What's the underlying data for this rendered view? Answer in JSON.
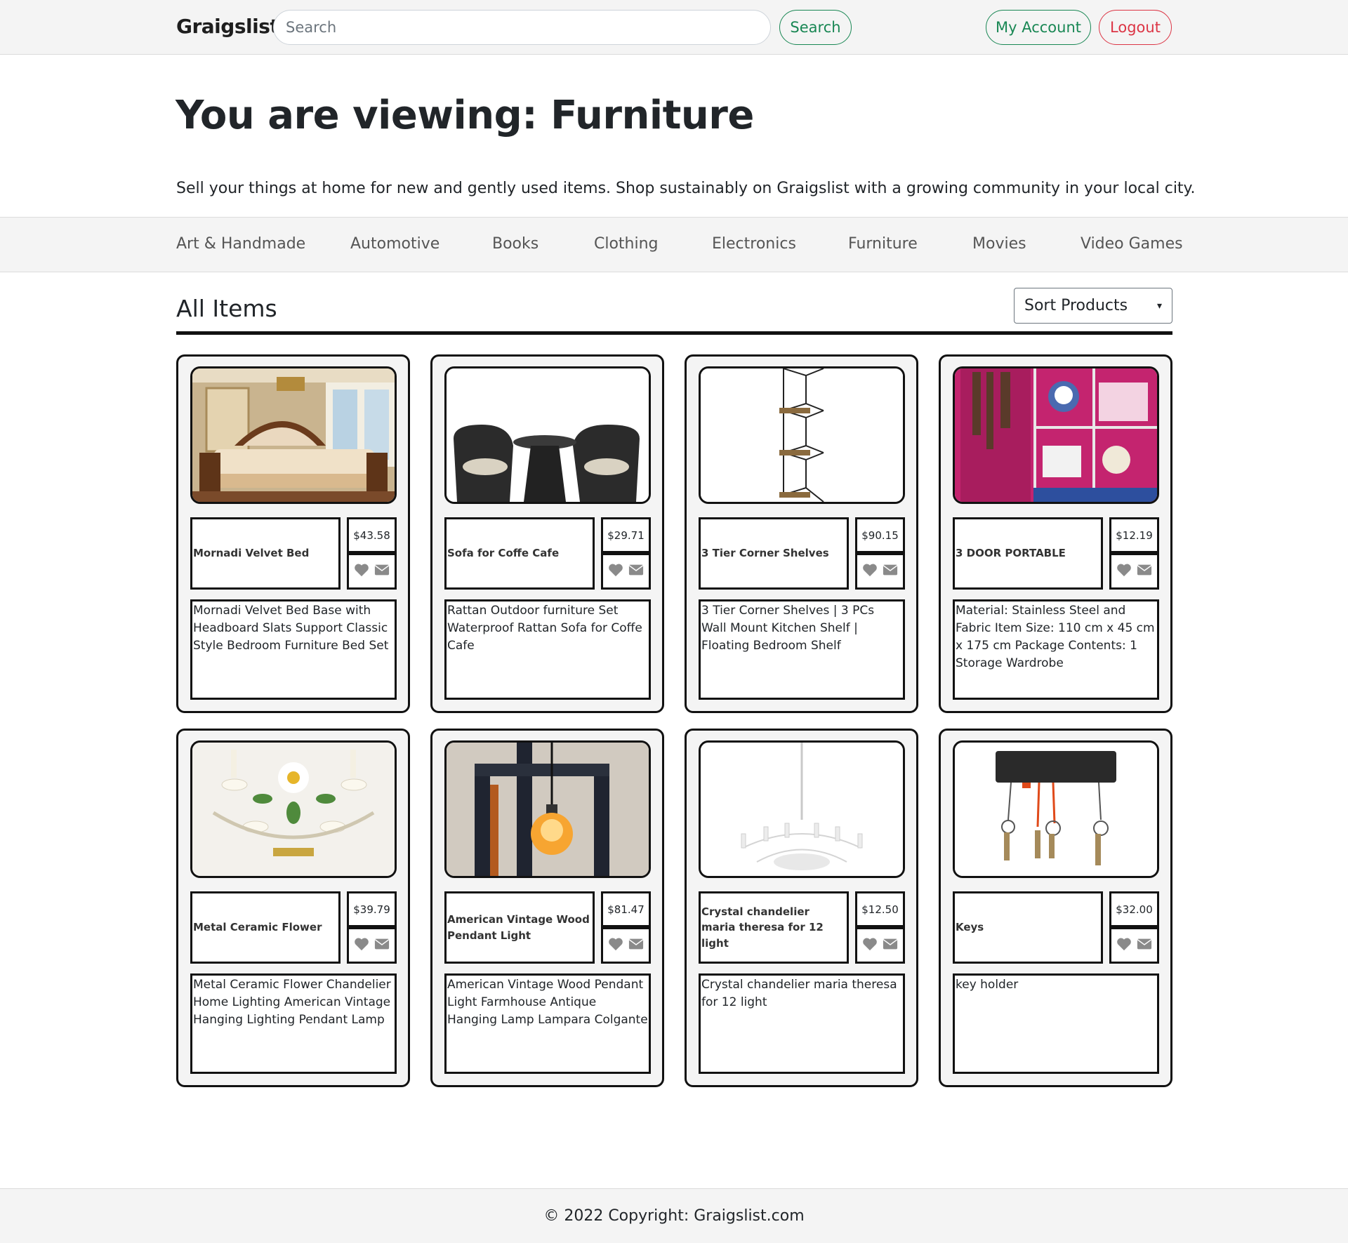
{
  "navbar": {
    "brand": "Graigslist",
    "search_placeholder": "Search",
    "search_button": "Search",
    "account_button": "My Account",
    "logout_button": "Logout"
  },
  "hero": {
    "title": "You are viewing: Furniture",
    "text": "Sell your things at home for new and gently used items. Shop sustainably on Graigslist with a growing community in your local city."
  },
  "categories": [
    "Art & Handmade",
    "Automotive",
    "Books",
    "Clothing",
    "Electronics",
    "Furniture",
    "Movies",
    "Video Games"
  ],
  "section": {
    "title": "All Items",
    "sort_label": "Sort Products"
  },
  "items": [
    {
      "name": "Mornadi Velvet Bed",
      "price": "$43.58",
      "description": "Mornadi Velvet Bed Base with Headboard Slats Support Classic Style Bedroom Furniture Bed Set",
      "image": "bed-photo"
    },
    {
      "name": "Sofa for Coffe Cafe",
      "price": "$29.71",
      "description": "Rattan Outdoor furniture Set Waterproof Rattan Sofa for Coffe Cafe",
      "image": "rattan-chairs-photo"
    },
    {
      "name": "3 Tier Corner Shelves",
      "price": "$90.15",
      "description": "3 Tier Corner Shelves | 3 PCs Wall Mount Kitchen Shelf | Floating Bedroom Shelf",
      "image": "corner-shelves-photo"
    },
    {
      "name": "3 DOOR PORTABLE",
      "price": "$12.19",
      "description": "Material: Stainless Steel and Fabric Item Size: 110 cm x 45 cm x 175 cm Package Contents: 1 Storage Wardrobe",
      "image": "portable-wardrobe-photo"
    },
    {
      "name": "Metal Ceramic Flower",
      "price": "$39.79",
      "description": "Metal Ceramic Flower Chandelier Home Lighting American Vintage Hanging Lighting Pendant Lamp",
      "image": "flower-chandelier-photo"
    },
    {
      "name": "American Vintage Wood Pendant Light",
      "price": "$81.47",
      "description": "American Vintage Wood Pendant Light Farmhouse Antique Hanging Lamp Lampara Colgante",
      "image": "wood-pendant-light-photo"
    },
    {
      "name": "Crystal chandelier maria theresa for 12 light",
      "price": "$12.50",
      "description": "Crystal chandelier maria theresa for 12 light",
      "image": "crystal-chandelier-photo"
    },
    {
      "name": "Keys",
      "price": "$32.00",
      "description": "key holder",
      "image": "key-holder-photo"
    }
  ],
  "icons": {
    "favorite": "heart-icon",
    "message": "envelope-icon"
  },
  "colors": {
    "success": "#198754",
    "danger": "#dc3545",
    "icon_gray": "#8a8a8a"
  },
  "footer": {
    "copyright": "© 2022 Copyright: Graigslist.com"
  }
}
